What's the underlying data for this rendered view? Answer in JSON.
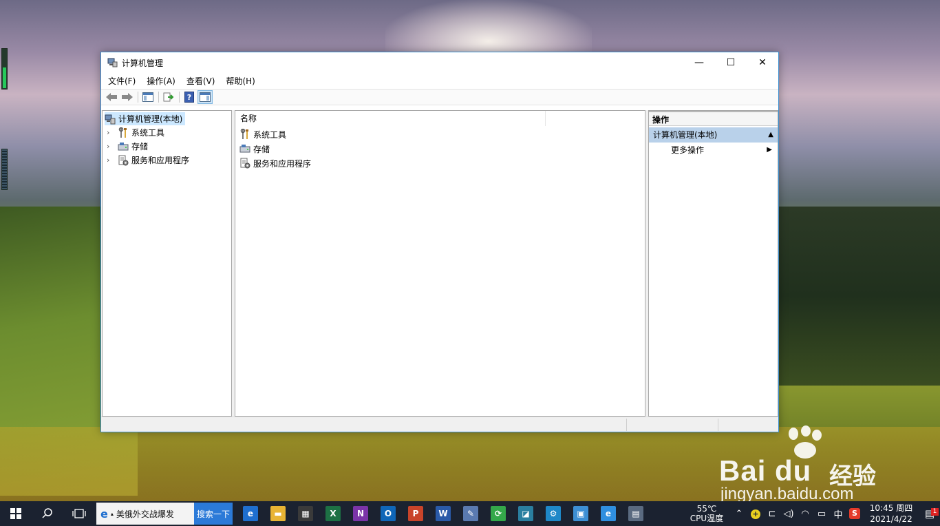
{
  "window": {
    "title": "计算机管理",
    "controls": {
      "minimize": "—",
      "maximize": "☐",
      "close": "✕"
    }
  },
  "menu": [
    "文件(F)",
    "操作(A)",
    "查看(V)",
    "帮助(H)"
  ],
  "toolbar": {
    "buttons": [
      "back-icon",
      "forward-icon",
      "show-hide-tree-icon",
      "export-list-icon",
      "help-icon",
      "show-hide-action-pane-icon"
    ]
  },
  "tree": {
    "root": "计算机管理(本地)",
    "children": [
      "系统工具",
      "存储",
      "服务和应用程序"
    ],
    "expander": "›"
  },
  "list": {
    "column_name": "名称",
    "items": [
      "系统工具",
      "存储",
      "服务和应用程序"
    ]
  },
  "actions": {
    "header": "操作",
    "section": "计算机管理(本地)",
    "section_arrow": "▲",
    "items": [
      {
        "label": "更多操作",
        "arrow": "▶"
      }
    ]
  },
  "watermark": {
    "brand": "Bai du",
    "jingyan": "经验",
    "url": "jingyan.baidu.com"
  },
  "taskbar": {
    "search_text": "美俄外交战爆发",
    "search_button": "搜索一下",
    "apps": [
      {
        "name": "edge-icon",
        "glyph": "e",
        "color": "#1f6fcf"
      },
      {
        "name": "file-explorer-icon",
        "glyph": "▬",
        "color": "#e8b434"
      },
      {
        "name": "store-icon",
        "glyph": "▦",
        "color": "#3a3a3a"
      },
      {
        "name": "excel-icon",
        "glyph": "X",
        "color": "#1d7044"
      },
      {
        "name": "onenote-icon",
        "glyph": "N",
        "color": "#7b34a8"
      },
      {
        "name": "outlook-icon",
        "glyph": "O",
        "color": "#0f66b8"
      },
      {
        "name": "powerpoint-icon",
        "glyph": "P",
        "color": "#c9442a"
      },
      {
        "name": "word-icon",
        "glyph": "W",
        "color": "#2a5aa8"
      },
      {
        "name": "paint-icon",
        "glyph": "✎",
        "color": "#5a7ab0"
      },
      {
        "name": "green-app-icon",
        "glyph": "⟳",
        "color": "#34a84a"
      },
      {
        "name": "photo-app-icon",
        "glyph": "◪",
        "color": "#2a7fa0"
      },
      {
        "name": "settings-app-icon",
        "glyph": "⚙",
        "color": "#1e88c8"
      },
      {
        "name": "system-info-icon",
        "glyph": "▣",
        "color": "#3d8fd4"
      },
      {
        "name": "ie-icon",
        "glyph": "e",
        "color": "#2f8fe0"
      },
      {
        "name": "computer-management-icon",
        "glyph": "▤",
        "color": "#5a6a80"
      }
    ],
    "cpu_temp": "55℃",
    "cpu_label": "CPU温度",
    "ime": "中",
    "time": "10:45 周四",
    "date": "2021/4/22",
    "notification_count": "1"
  }
}
